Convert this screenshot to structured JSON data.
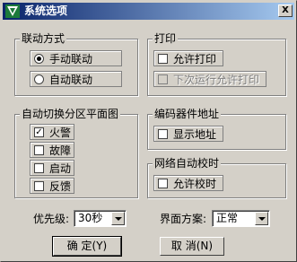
{
  "window": {
    "title": "系统选项",
    "close_label": "X",
    "icon": "app-icon"
  },
  "link_mode": {
    "title": "联动方式",
    "options": [
      {
        "label": "手动联动",
        "selected": true
      },
      {
        "label": "自动联动",
        "selected": false
      }
    ]
  },
  "print": {
    "title": "打印",
    "options": [
      {
        "label": "允许打印",
        "checked": false,
        "enabled": true
      },
      {
        "label": "下次运行允许打印",
        "checked": false,
        "enabled": false
      }
    ]
  },
  "auto_switch": {
    "title": "自动切换分区平面图",
    "options": [
      {
        "label": "火警",
        "checked": true
      },
      {
        "label": "故障",
        "checked": false
      },
      {
        "label": "启动",
        "checked": false
      },
      {
        "label": "反馈",
        "checked": false
      }
    ]
  },
  "encoder_address": {
    "title": "编码器件地址",
    "options": [
      {
        "label": "显示地址",
        "checked": false
      }
    ]
  },
  "network_time": {
    "title": "网络自动校时",
    "options": [
      {
        "label": "允许校时",
        "checked": false
      }
    ]
  },
  "priority": {
    "label": "优先级:",
    "value": "30秒"
  },
  "ui_scheme": {
    "label": "界面方案:",
    "value": "正常"
  },
  "buttons": {
    "ok_label": "确 定(Y)",
    "cancel_label": "取 消(N)"
  },
  "colors": {
    "face": "#d4d0c8",
    "title_start": "#0a246a",
    "title_end": "#a6caf0"
  }
}
